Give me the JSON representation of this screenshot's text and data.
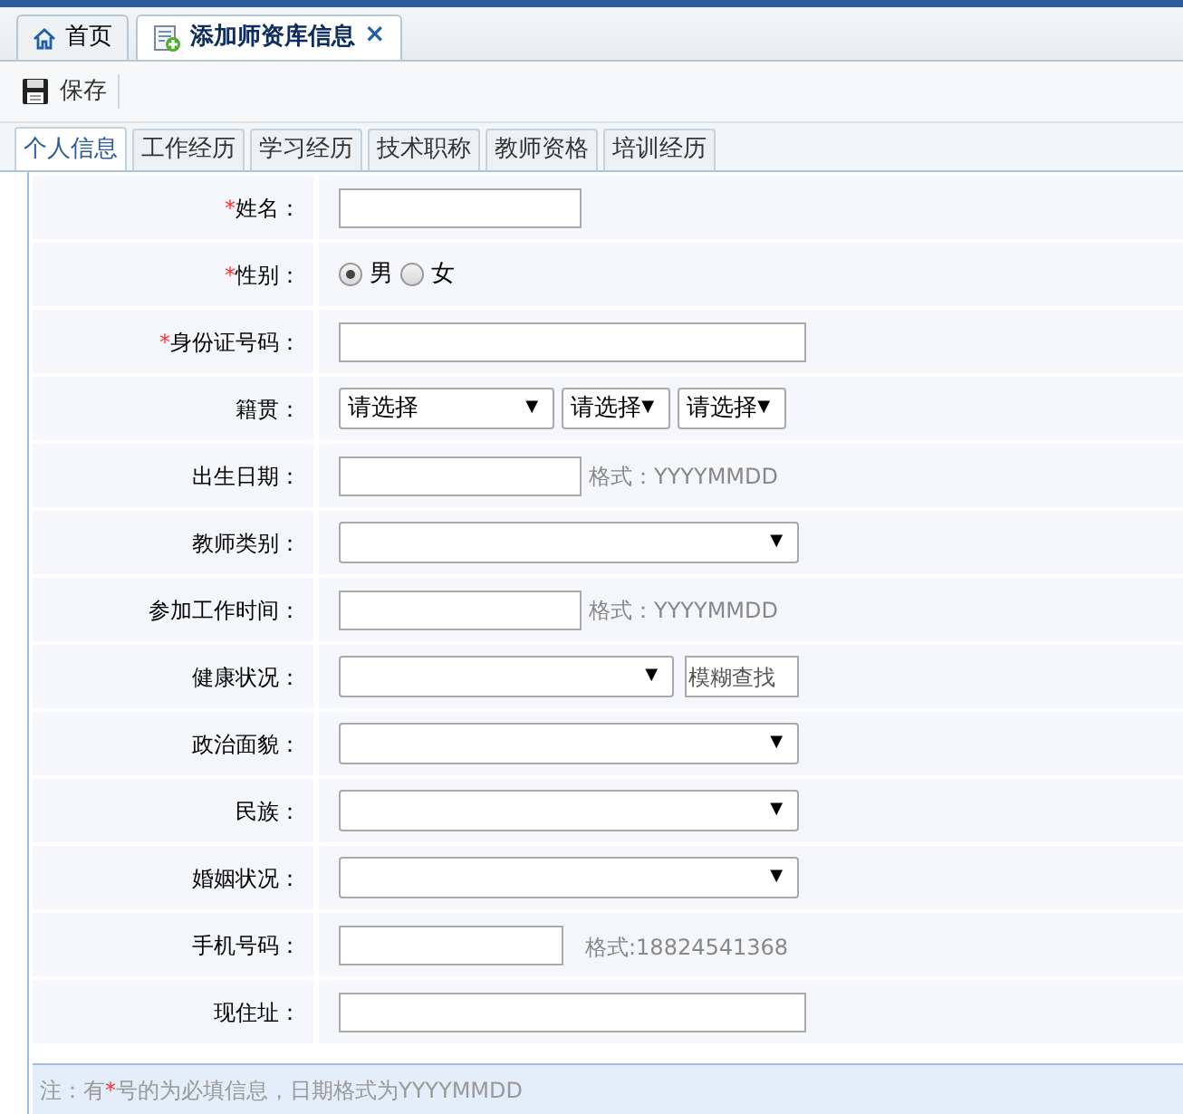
{
  "tabs": [
    {
      "label": "首页",
      "kind": "home",
      "selected": false
    },
    {
      "label": "添加师资库信息",
      "kind": "document",
      "selected": true,
      "close": "×"
    }
  ],
  "toolbar": {
    "buttons": [
      {
        "label": "保存"
      }
    ]
  },
  "sub_tabs": [
    {
      "label": "个人信息",
      "selected": true
    },
    {
      "label": "工作经历",
      "selected": false
    },
    {
      "label": "学习经历",
      "selected": false
    },
    {
      "label": "技术职称",
      "selected": false
    },
    {
      "label": "教师资格",
      "selected": false
    },
    {
      "label": "培训经历",
      "selected": false
    }
  ],
  "form": {
    "rows": [
      {
        "label": "姓名：",
        "mark": "*",
        "kind": "input"
      },
      {
        "label": "性别：",
        "mark": "*",
        "kind": "radio",
        "options": [
          {
            "label": "男",
            "selected": true
          },
          {
            "label": "女",
            "selected": false
          }
        ]
      },
      {
        "label": "身份证号码：",
        "mark": "*",
        "kind": "long-input"
      },
      {
        "label": "籍贯：",
        "kind": "selects",
        "selects": [
          {
            "value": "请选择",
            "arrow": "▼"
          },
          {
            "value": "请选择",
            "arrow": "▼"
          },
          {
            "value": "请选择",
            "arrow": "▼"
          }
        ]
      },
      {
        "label": "出生日期：",
        "kind": "input",
        "hint": "格式：YYYYMMDD"
      },
      {
        "label": "教师类别：",
        "kind": "select",
        "arrow": "▼"
      },
      {
        "label": "参加工作时间：",
        "kind": "input",
        "hint": "格式：YYYYMMDD"
      },
      {
        "label": "健康状况：",
        "kind": "select-search",
        "arrow": "▼",
        "placeholder": "模糊查找"
      },
      {
        "label": "政治面貌：",
        "kind": "select",
        "arrow": "▼"
      },
      {
        "label": "民族：",
        "kind": "select",
        "arrow": "▼"
      },
      {
        "label": "婚姻状况：",
        "kind": "select",
        "arrow": "▼"
      },
      {
        "label": "手机号码：",
        "kind": "short-input",
        "hint": "格式:18824541368"
      },
      {
        "label": "现住址：",
        "kind": "long-input"
      }
    ]
  },
  "note": {
    "before": "注：有",
    "mark": "*",
    "after": "号的为必填信息，日期格式为YYYYMMDD"
  }
}
